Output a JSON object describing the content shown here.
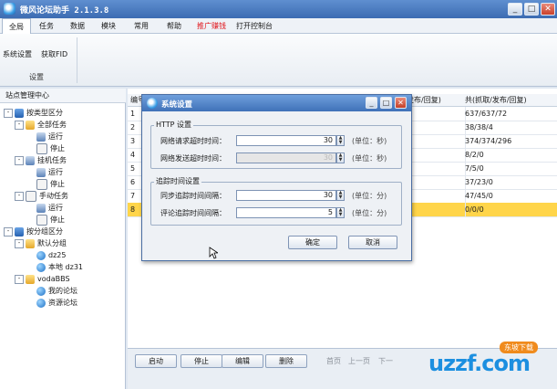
{
  "window": {
    "title": "微风论坛助手 2.1.3.8"
  },
  "menu": {
    "tabs": [
      {
        "label": "全局",
        "active": true
      },
      {
        "label": "任务"
      },
      {
        "label": "数据"
      },
      {
        "label": "模块"
      },
      {
        "label": "常用"
      },
      {
        "label": "帮助"
      },
      {
        "label": "推广赚钱",
        "color": "#e0161c"
      },
      {
        "label": "打开控制台"
      }
    ]
  },
  "ribbon": {
    "items": [
      "系统设置",
      "获取FID"
    ],
    "group_label": "设置"
  },
  "tree": {
    "header": "站点管理中心",
    "nodes": [
      {
        "label": "按类型区分",
        "level": 0,
        "icon": "server-icon",
        "expand": "-"
      },
      {
        "label": "全部任务",
        "level": 1,
        "icon": "folder-icon",
        "expand": "-"
      },
      {
        "label": "运行",
        "level": 2,
        "icon": "task-icon"
      },
      {
        "label": "停止",
        "level": 2,
        "icon": "doc-icon"
      },
      {
        "label": "挂机任务",
        "level": 1,
        "icon": "task-icon",
        "expand": "-"
      },
      {
        "label": "运行",
        "level": 2,
        "icon": "task-icon"
      },
      {
        "label": "停止",
        "level": 2,
        "icon": "doc-icon"
      },
      {
        "label": "手动任务",
        "level": 1,
        "icon": "doc-icon",
        "expand": "-"
      },
      {
        "label": "运行",
        "level": 2,
        "icon": "task-icon"
      },
      {
        "label": "停止",
        "level": 2,
        "icon": "doc-icon"
      },
      {
        "label": "按分组区分",
        "level": 0,
        "icon": "server-icon",
        "expand": "-"
      },
      {
        "label": "默认分组",
        "level": 1,
        "icon": "folder-icon",
        "expand": "-"
      },
      {
        "label": "dz25",
        "level": 2,
        "icon": "globe-icon"
      },
      {
        "label": "本地 dz31",
        "level": 2,
        "icon": "globe-icon"
      },
      {
        "label": "vodaBBS",
        "level": 1,
        "icon": "folder-icon",
        "expand": "-"
      },
      {
        "label": "我的论坛",
        "level": 2,
        "icon": "globe-icon"
      },
      {
        "label": "资源论坛",
        "level": 2,
        "icon": "globe-icon"
      }
    ]
  },
  "grid": {
    "headers": [
      "编号",
      "发布/回复)",
      "共(抓取/发布/回复)"
    ],
    "rows": [
      {
        "id": "1",
        "total": "637/637/72"
      },
      {
        "id": "2",
        "total": "38/38/4"
      },
      {
        "id": "3",
        "total": "374/374/296"
      },
      {
        "id": "4",
        "total": "8/2/0"
      },
      {
        "id": "5",
        "total": "7/5/0"
      },
      {
        "id": "6",
        "total": "37/23/0"
      },
      {
        "id": "7",
        "total": "47/45/0"
      },
      {
        "id": "8",
        "total": "0/0/0",
        "selected": true
      }
    ]
  },
  "bottom": {
    "buttons": [
      "启动",
      "停止",
      "编辑",
      "删除"
    ],
    "pager": [
      "首页",
      "上一页",
      "下一"
    ]
  },
  "dialog": {
    "title": "系统设置",
    "http_group": {
      "title": "HTTP 设置",
      "fields": [
        {
          "label": "网络请求超时时间：",
          "value": "30",
          "unit": "(单位：秒)",
          "disabled": false
        },
        {
          "label": "网络发送超时时间：",
          "value": "30",
          "unit": "(单位：秒)",
          "disabled": true
        }
      ]
    },
    "track_group": {
      "title": "追踪时间设置",
      "fields": [
        {
          "label": "同步追踪时间间隔：",
          "value": "30",
          "unit": "(单位：分)"
        },
        {
          "label": "评论追踪时间间隔：",
          "value": "5",
          "unit": "(单位：分)"
        }
      ]
    },
    "ok_label": "确定",
    "cancel_label": "取消"
  },
  "watermark": {
    "text": "uzzf.com",
    "badge": "东坡下载"
  },
  "colors": {
    "titlebar": "#3c6cb2",
    "selected_row": "#ffd54a",
    "promo": "#e0161c"
  }
}
